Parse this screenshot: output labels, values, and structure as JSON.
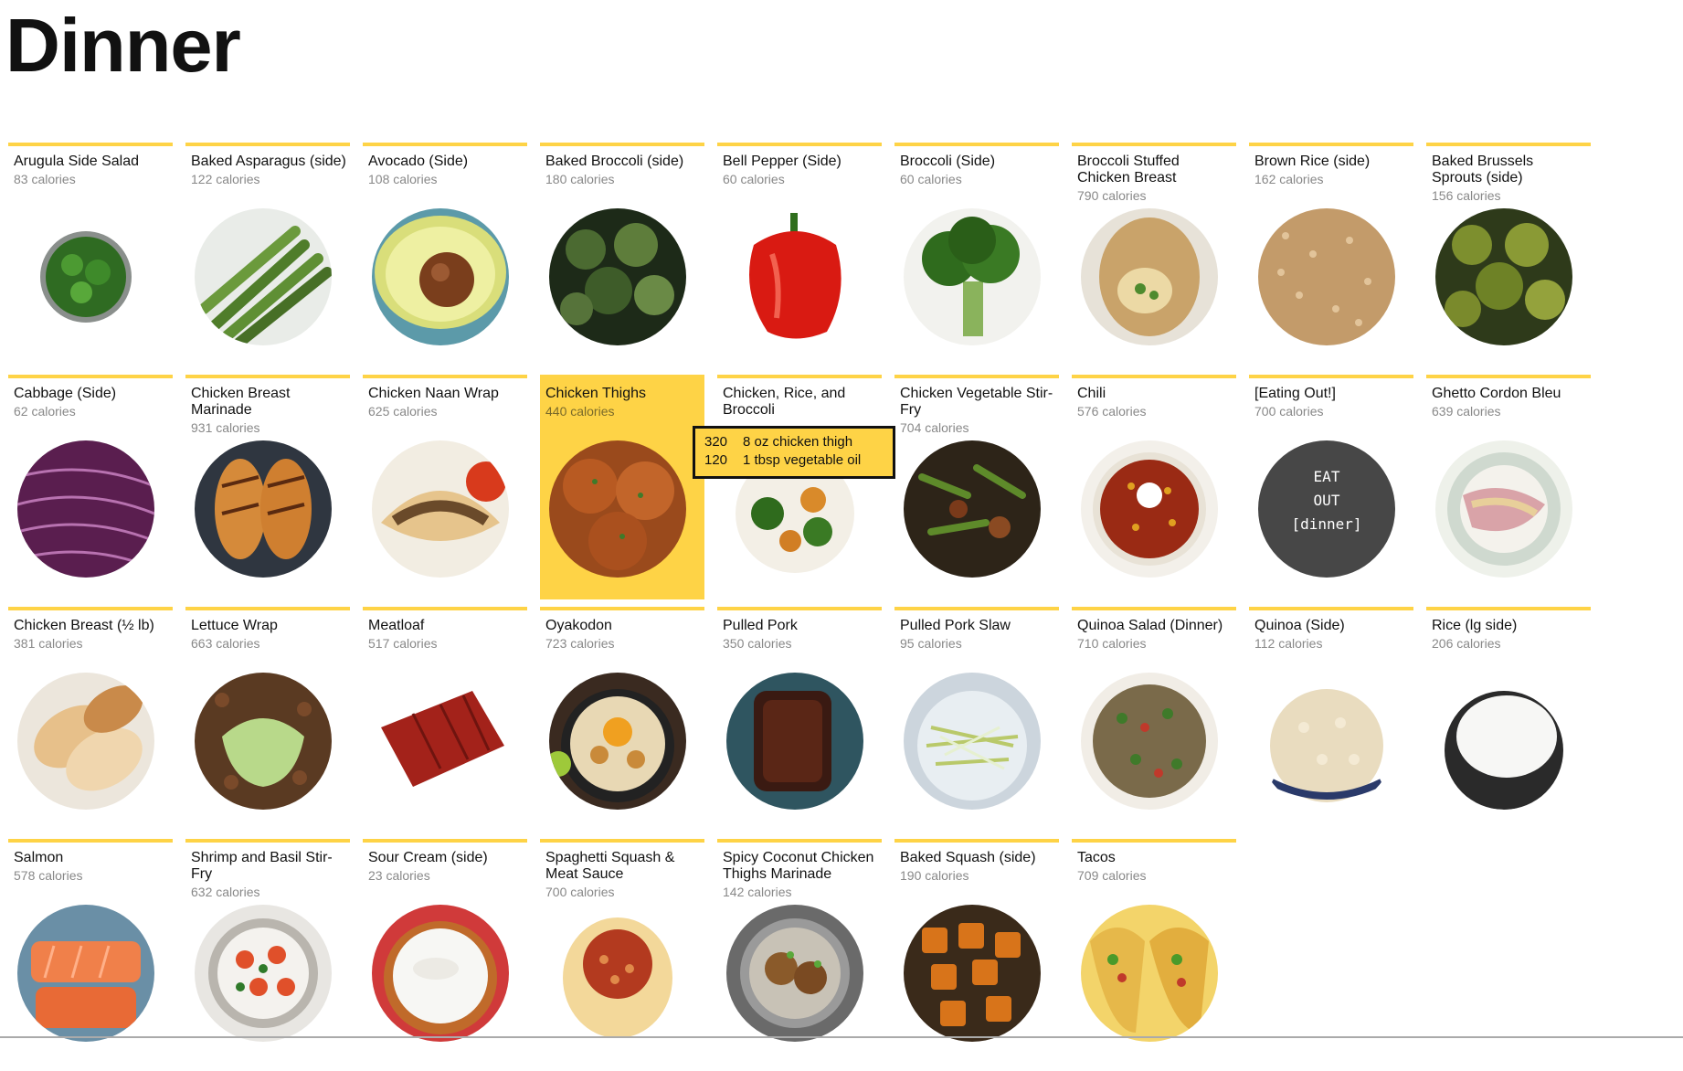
{
  "page": {
    "title": "Dinner"
  },
  "calories_suffix": "calories",
  "items": [
    {
      "name": "Arugula Side Salad",
      "calories": "83 calories",
      "image": "arugula-salad"
    },
    {
      "name": "Baked Asparagus (side)",
      "calories": "122 calories",
      "image": "asparagus"
    },
    {
      "name": "Avocado (Side)",
      "calories": "108 calories",
      "image": "avocado"
    },
    {
      "name": "Baked Broccoli (side)",
      "calories": "180 calories",
      "image": "roasted-broccoli"
    },
    {
      "name": "Bell Pepper (Side)",
      "calories": "60 calories",
      "image": "red-bell-pepper"
    },
    {
      "name": "Broccoli (Side)",
      "calories": "60 calories",
      "image": "broccoli"
    },
    {
      "name": "Broccoli Stuffed Chicken Breast",
      "calories": "790 calories",
      "image": "stuffed-chicken"
    },
    {
      "name": "Brown Rice (side)",
      "calories": "162 calories",
      "image": "brown-rice"
    },
    {
      "name": "Baked Brussels Sprouts (side)",
      "calories": "156 calories",
      "image": "brussels-sprouts"
    },
    {
      "name": "Cabbage (Side)",
      "calories": "62 calories",
      "image": "red-cabbage"
    },
    {
      "name": "Chicken Breast Marinade",
      "calories": "931 calories",
      "image": "grilled-chicken"
    },
    {
      "name": "Chicken Naan Wrap",
      "calories": "625 calories",
      "image": "naan-wrap"
    },
    {
      "name": "Chicken Thighs",
      "calories": "440 calories",
      "image": "chicken-thighs",
      "active": true
    },
    {
      "name": "Chicken, Rice, and Broccoli",
      "calories": "",
      "image": "chicken-rice-broccoli"
    },
    {
      "name": "Chicken Vegetable Stir-Fry",
      "calories": "704 calories",
      "image": "stir-fry"
    },
    {
      "name": "Chili",
      "calories": "576 calories",
      "image": "chili"
    },
    {
      "name": "[Eating Out!]",
      "calories": "700 calories",
      "image": "eat-out"
    },
    {
      "name": "Ghetto Cordon Bleu",
      "calories": "639 calories",
      "image": "cordon-bleu"
    },
    {
      "name": "Chicken Breast (½ lb)",
      "calories": "381 calories",
      "image": "chicken-breast"
    },
    {
      "name": "Lettuce Wrap",
      "calories": "663 calories",
      "image": "lettuce-wrap"
    },
    {
      "name": "Meatloaf",
      "calories": "517 calories",
      "image": "meatloaf"
    },
    {
      "name": "Oyakodon",
      "calories": "723 calories",
      "image": "oyakodon"
    },
    {
      "name": "Pulled Pork",
      "calories": "350 calories",
      "image": "pulled-pork"
    },
    {
      "name": "Pulled Pork Slaw",
      "calories": "95 calories",
      "image": "slaw"
    },
    {
      "name": "Quinoa Salad (Dinner)",
      "calories": "710 calories",
      "image": "quinoa-salad"
    },
    {
      "name": "Quinoa (Side)",
      "calories": "112 calories",
      "image": "quinoa"
    },
    {
      "name": "Rice (lg side)",
      "calories": "206 calories",
      "image": "white-rice"
    },
    {
      "name": "Salmon",
      "calories": "578 calories",
      "image": "salmon"
    },
    {
      "name": "Shrimp and Basil Stir-Fry",
      "calories": "632 calories",
      "image": "shrimp-stir-fry"
    },
    {
      "name": "Sour Cream (side)",
      "calories": "23 calories",
      "image": "sour-cream"
    },
    {
      "name": "Spaghetti Squash & Meat Sauce",
      "calories": "700 calories",
      "image": "spaghetti-squash"
    },
    {
      "name": "Spicy Coconut Chicken Thighs Marinade",
      "calories": "142 calories",
      "image": "coconut-chicken"
    },
    {
      "name": "Baked Squash (side)",
      "calories": "190 calories",
      "image": "baked-squash"
    },
    {
      "name": "Tacos",
      "calories": "709 calories",
      "image": "tacos"
    }
  ],
  "eat_out_badge": [
    "EAT",
    "OUT",
    "[dinner]"
  ],
  "tooltip": {
    "rows": [
      {
        "calories": "320",
        "ingredient": "8 oz chicken thigh"
      },
      {
        "calories": "120",
        "ingredient": "1 tbsp vegetable oil"
      }
    ]
  },
  "colors": {
    "accent": "#fed346",
    "muted_text": "#888888"
  }
}
